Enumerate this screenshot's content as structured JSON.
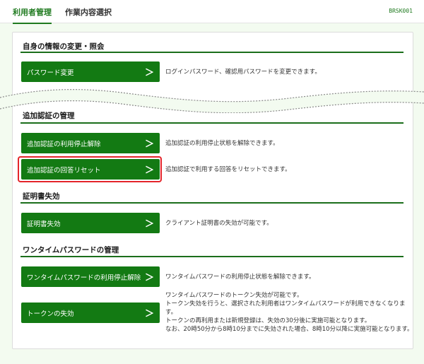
{
  "topbar": {
    "tab_main": "利用者管理",
    "tab_sub": "作業内容選択",
    "screen_code": "BRSK001"
  },
  "sections": {
    "own": {
      "title": "自身の情報の変更・照会",
      "items": [
        {
          "label": "パスワード変更",
          "desc": "ログインパスワード、確認用パスワードを変更できます。"
        }
      ]
    },
    "additional_auth": {
      "title": "追加認証の管理",
      "items": [
        {
          "label": "追加認証の利用停止解除",
          "desc": "追加認証の利用停止状態を解除できます。"
        },
        {
          "label": "追加認証の回答リセット",
          "desc": "追加認証で利用する回答をリセットできます。"
        }
      ]
    },
    "cert": {
      "title": "証明書失効",
      "items": [
        {
          "label": "証明書失効",
          "desc": "クライアント証明書の失効が可能です。"
        }
      ]
    },
    "otp": {
      "title": "ワンタイムパスワードの管理",
      "items": [
        {
          "label": "ワンタイムパスワードの利用停止解除",
          "desc": "ワンタイムパスワードの利用停止状態を解除できます。"
        },
        {
          "label": "トークンの失効",
          "desc_lines": [
            "ワンタイムパスワードのトークン失効が可能です。",
            "トークン失効を行うと、選択された利用者はワンタイムパスワードが利用できなくなりま",
            "す。",
            "トークンの再利用または新規登録は、失効の30分後に実施可能となります。",
            "なお、20時50分から8時10分までに失効された場合、8時10分以降に実施可能となります。"
          ]
        }
      ]
    }
  },
  "chevron": "＞",
  "colors": {
    "brand_green": "#137a13",
    "highlight_red": "#e4252a",
    "background": "#f3fbf0"
  }
}
